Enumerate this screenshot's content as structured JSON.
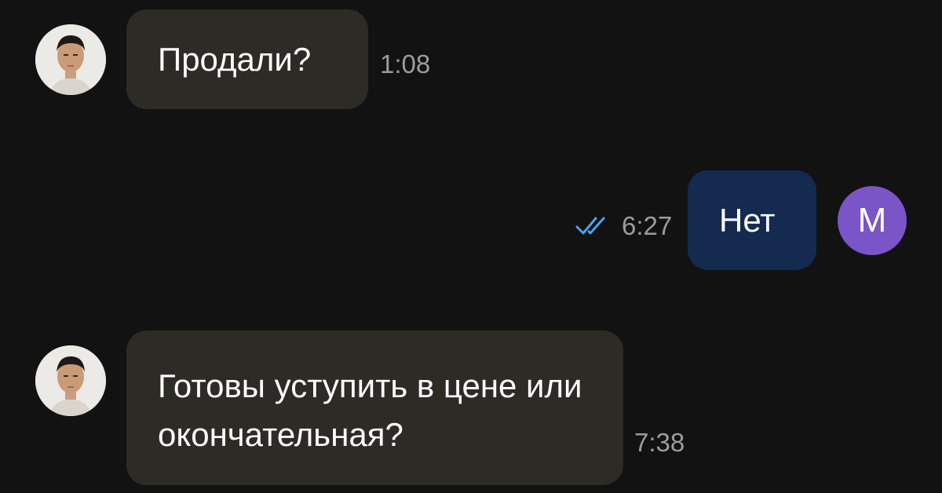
{
  "messages": [
    {
      "text": "Продали?",
      "time": "1:08"
    },
    {
      "text": "Нет",
      "time": "6:27",
      "status_icon": "double-check-icon",
      "avatar_letter": "M"
    },
    {
      "text": "Готовы уступить в цене или окончательная?",
      "time": "7:38"
    }
  ],
  "colors": {
    "background": "#121212",
    "incoming_bubble": "#2d2b26",
    "outgoing_bubble": "#142a4f",
    "avatar_letter_bg": "#7a55c8",
    "read_check": "#4aa3f0"
  }
}
